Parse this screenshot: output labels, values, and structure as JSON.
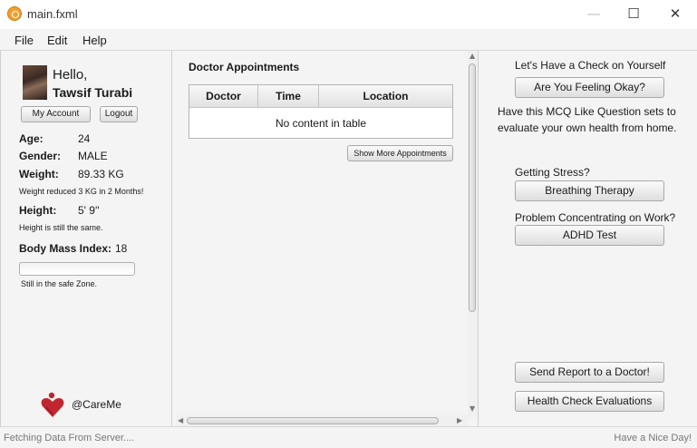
{
  "window": {
    "title": "main.fxml",
    "icon": "app-icon",
    "controls": {
      "minimize": "—",
      "maximize": "☐",
      "close": "✕"
    }
  },
  "menu": {
    "items": [
      "File",
      "Edit",
      "Help"
    ]
  },
  "profile": {
    "greeting": "Hello,",
    "name": "Tawsif Turabi",
    "my_account_label": "My Account",
    "logout_label": "Logout",
    "age_label": "Age:",
    "age_value": "24",
    "gender_label": "Gender:",
    "gender_value": "MALE",
    "weight_label": "Weight:",
    "weight_value": "89.33 KG",
    "weight_note": "Weight reduced 3 KG in 2 Months!",
    "height_label": "Height:",
    "height_value": "5' 9''",
    "height_note": "Height is still the same.",
    "bmi_label": "Body Mass Index:",
    "bmi_value": "18",
    "bmi_progress": 0,
    "bmi_note": "Still in the safe Zone."
  },
  "brand": {
    "logo_icon": "heart-logo-icon",
    "name": "@CareMe"
  },
  "appointments": {
    "title": "Doctor Appointments",
    "columns": [
      "Doctor",
      "Time",
      "Location"
    ],
    "empty_text": "No content in table",
    "show_more_label": "Show More Appointments"
  },
  "checkup": {
    "heading": "Let's Have a Check on Yourself",
    "feeling_button": "Are You Feeling Okay?",
    "mcq_line1": "Have this MCQ Like Question sets to",
    "mcq_line2": "evaluate your own health from home.",
    "stress_label": "Getting Stress?",
    "breathing_button": "Breathing Therapy",
    "concentration_label": "Problem Concentrating on Work?",
    "adhd_button": "ADHD Test",
    "send_report_button": "Send Report to a Doctor!",
    "evaluations_button": "Health Check Evaluations"
  },
  "status": {
    "left": "Fetching Data From Server....",
    "right": "Have a Nice Day!"
  }
}
